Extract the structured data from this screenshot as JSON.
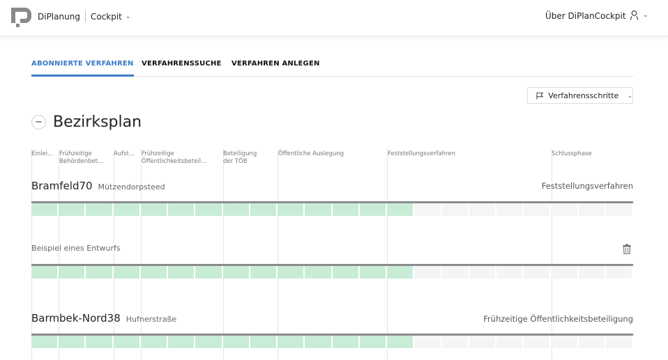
{
  "header": {
    "logo_icon": "diplanung-logo",
    "brand": "DiPlanung",
    "app": "Cockpit",
    "about_link": "Über DiPlanCockpit",
    "user_icon": "user-icon"
  },
  "tabs": [
    {
      "label": "ABONNIERTE VERFAHREN",
      "active": true
    },
    {
      "label": "VERFAHRENSSUCHE",
      "active": false
    },
    {
      "label": "VERFAHREN ANLEGEN",
      "active": false
    }
  ],
  "filter_button": {
    "label": "Verfahrensschritte",
    "icon": "flag-icon"
  },
  "section": {
    "title": "Bezirksplan",
    "collapse_symbol": "−"
  },
  "phases": [
    {
      "label": "Einlei...",
      "line1": "Einlei...",
      "line2": ""
    },
    {
      "label": "Frühzeitige Behördenbet...",
      "line1": "Frühzeitige",
      "line2": "Behördenbet..."
    },
    {
      "label": "Aufst...",
      "line1": "Aufst...",
      "line2": ""
    },
    {
      "label": "Frühzeitige Öffentlichkeitsbeteil...",
      "line1": "Frühzeitige",
      "line2": "Öffentlichkeitsbeteil..."
    },
    {
      "label": "Beteiligung der TÖB",
      "line1": "Beteiligung",
      "line2": "der TÖB"
    },
    {
      "label": "Öffentliche Auslegung",
      "line1": "Öffentliche Auslegung",
      "line2": ""
    },
    {
      "label": "Feststellungsverfahren",
      "line1": "Feststellungsverfahren",
      "line2": ""
    },
    {
      "label": "Schlussphase",
      "line1": "Schlussphase",
      "line2": ""
    }
  ],
  "procedures": [
    {
      "name": "Bramfeld70",
      "subtitle": "Mützendorpsteed",
      "current_phase": "Feststellungsverfahren",
      "segments_total": 22,
      "segments_done": 14
    },
    {
      "name": "",
      "subtitle": "Beispiel eines Entwurfs",
      "current_phase": "",
      "segments_total": 22,
      "segments_done": 14,
      "delete_icon": "trash-icon"
    },
    {
      "name": "Barmbek-Nord38",
      "subtitle": "Hufnerstraße",
      "current_phase": "Frühzeitige Öffentlichkeitsbeteiligung",
      "segments_total": 22,
      "segments_done": 14
    }
  ]
}
